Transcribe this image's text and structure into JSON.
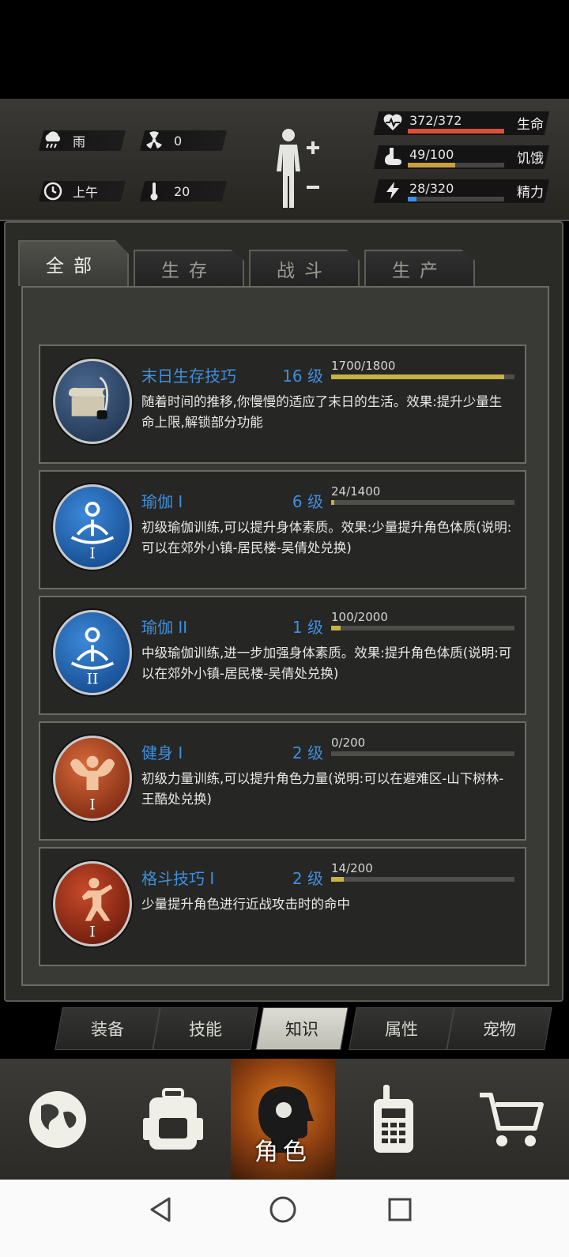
{
  "status": {
    "weather": "雨",
    "radiation": "0",
    "time_of_day": "上午",
    "temperature": "20",
    "stats": [
      {
        "icon": "heart-pulse-icon",
        "value": "372/372",
        "label": "生命",
        "ratio": 1.0,
        "color": "#d9503a"
      },
      {
        "icon": "stomach-icon",
        "value": "49/100",
        "label": "饥饿",
        "ratio": 0.49,
        "color": "#c8a040"
      },
      {
        "icon": "energy-icon",
        "value": "28/320",
        "label": "精力",
        "ratio": 0.0875,
        "color": "#3e8fe0"
      }
    ]
  },
  "tabs": [
    "全部",
    "生存",
    "战斗",
    "生产"
  ],
  "skills": [
    {
      "title": "末日生存技巧",
      "level": "16 级",
      "progress": "1700/1800",
      "ratio": 0.944,
      "desc": "随着时间的推移,你慢慢的适应了末日的生活。效果:提升少量生命上限,解锁部分功能",
      "icon": "scroll-quill-icon"
    },
    {
      "title": "瑜伽 I",
      "level": "6 级",
      "progress": "24/1400",
      "ratio": 0.017,
      "desc": "初级瑜伽训练,可以提升身体素质。效果:少量提升角色体质(说明:可以在郊外小镇-居民楼-吴倩处兑换)",
      "icon": "yoga-i-icon"
    },
    {
      "title": "瑜伽 II",
      "level": "1 级",
      "progress": "100/2000",
      "ratio": 0.05,
      "desc": "中级瑜伽训练,进一步加强身体素质。效果:提升角色体质(说明:可以在郊外小镇-居民楼-吴倩处兑换)",
      "icon": "yoga-ii-icon"
    },
    {
      "title": "健身 I",
      "level": "2 级",
      "progress": "0/200",
      "ratio": 0.0,
      "desc": "初级力量训练,可以提升角色力量(说明:可以在避难区-山下树林-王酷处兑换)",
      "icon": "fitness-i-icon"
    },
    {
      "title": "格斗技巧 I",
      "level": "2 级",
      "progress": "14/200",
      "ratio": 0.07,
      "desc": "少量提升角色进行近战攻击时的命中",
      "icon": "martial-arts-i-icon"
    }
  ],
  "subnav": [
    "装备",
    "技能",
    "知识",
    "属性",
    "宠物"
  ],
  "bottom_nav": {
    "character_label": "角色"
  }
}
